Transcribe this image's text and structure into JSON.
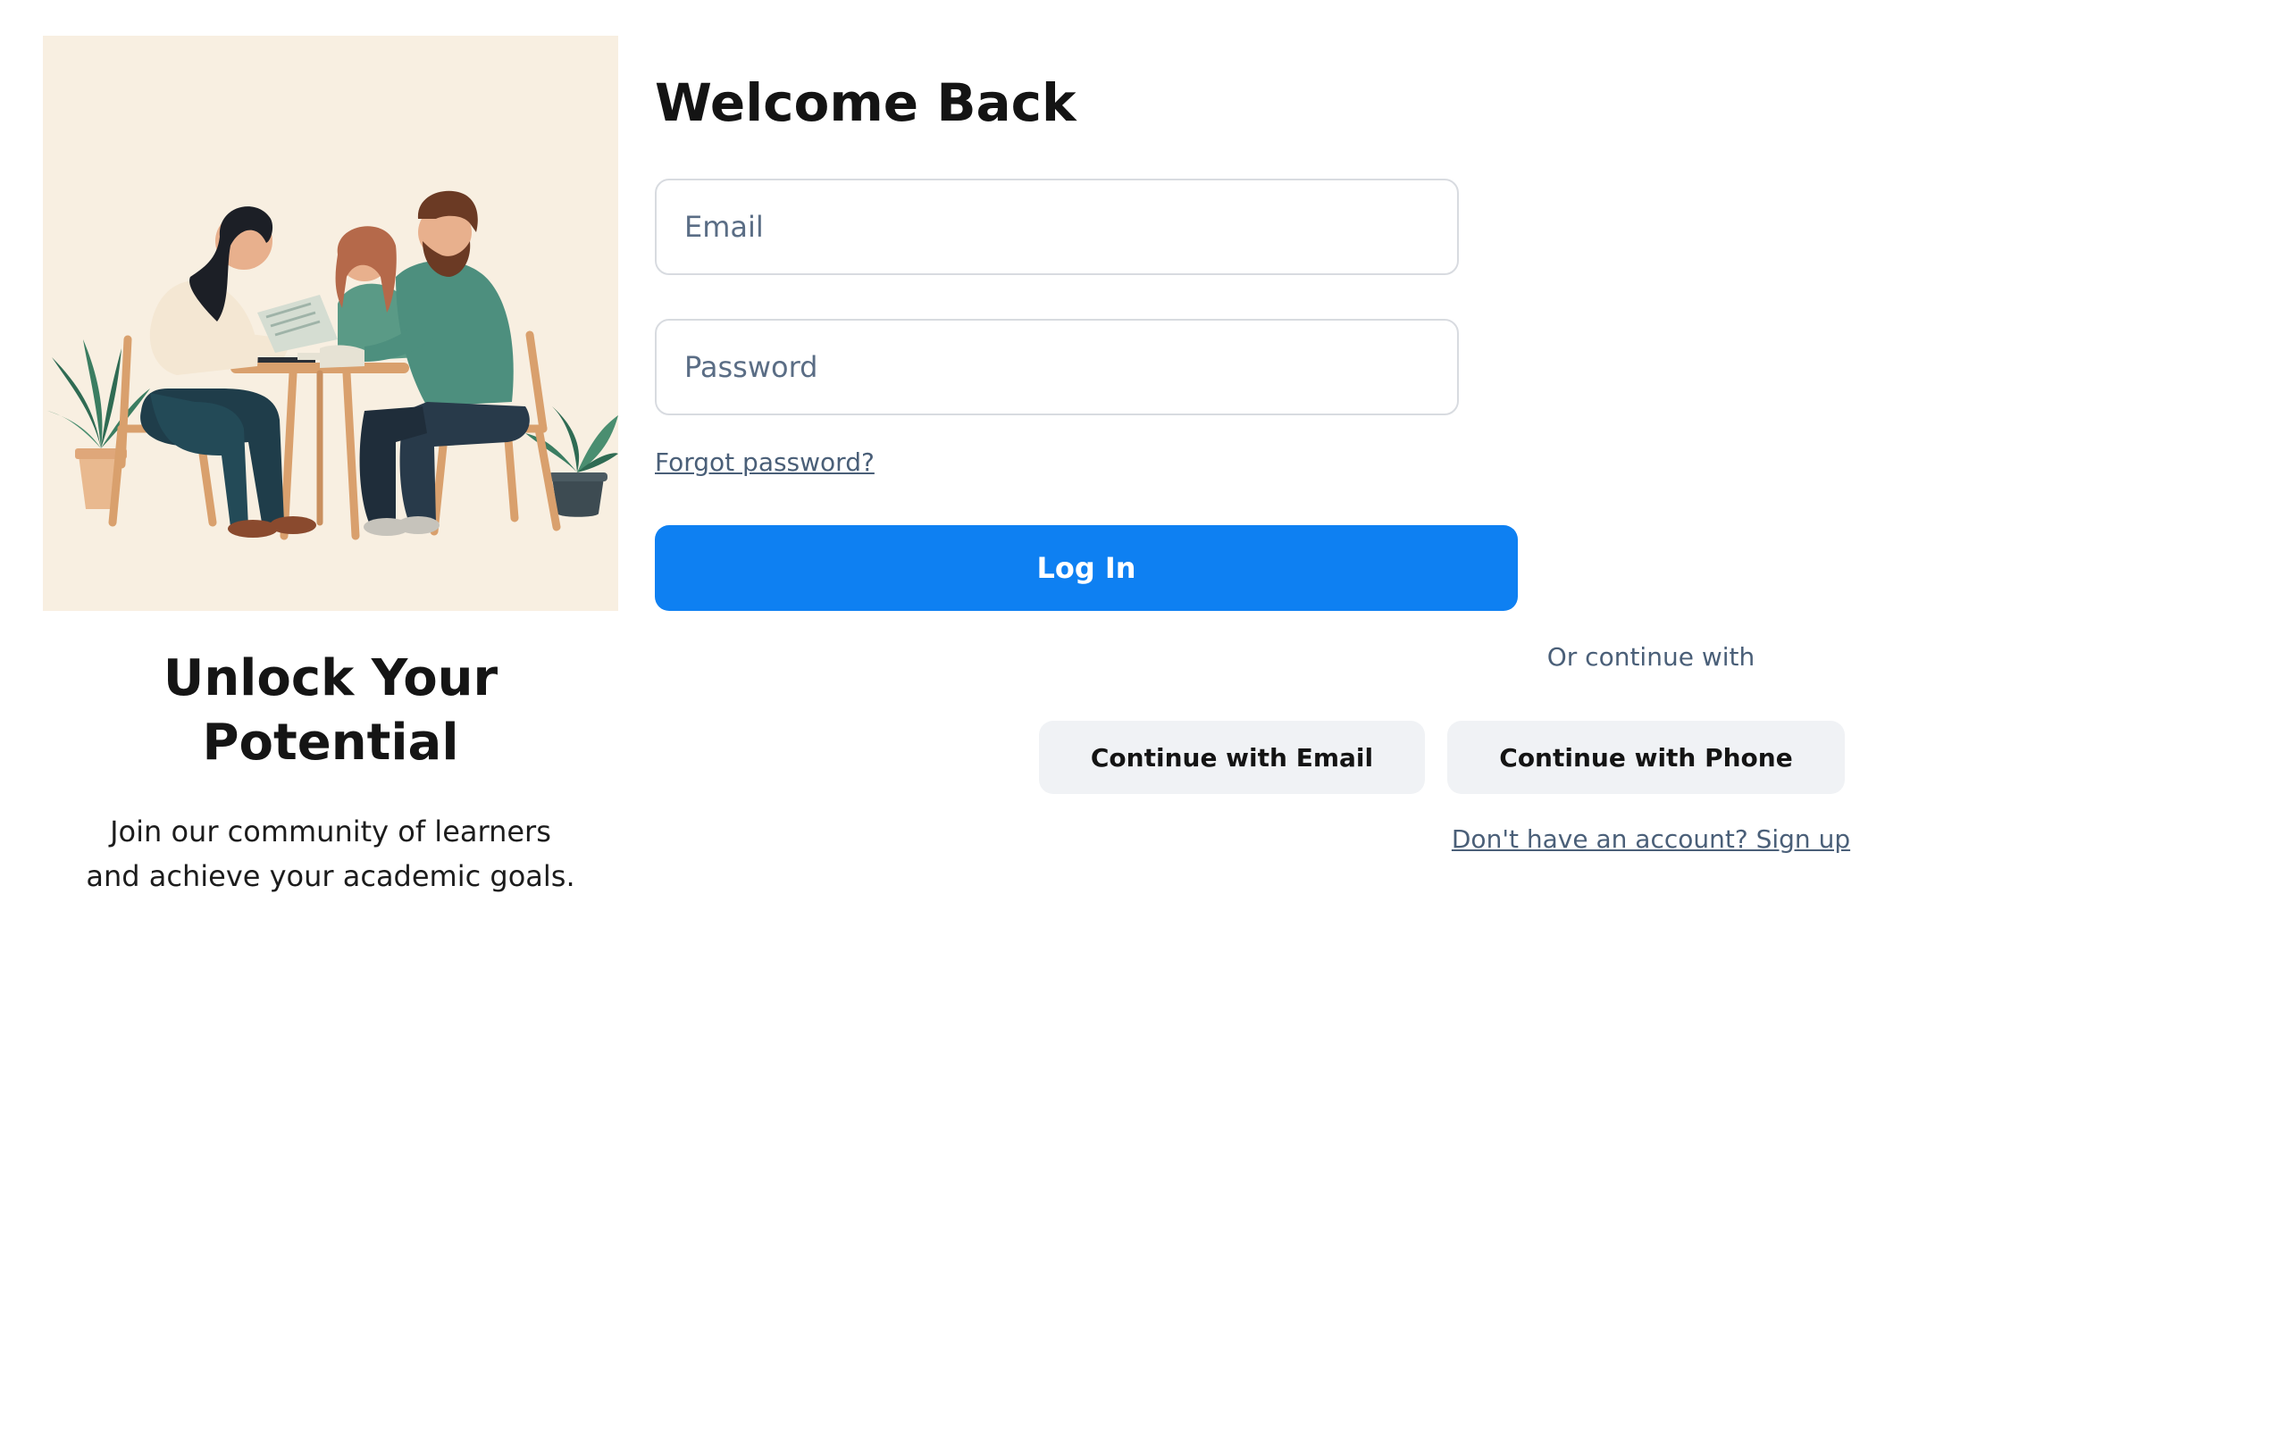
{
  "hero": {
    "title": "Unlock Your Potential",
    "subtitle": "Join our community of learners and achieve your academic goals."
  },
  "login": {
    "title": "Welcome Back",
    "email_placeholder": "Email",
    "password_placeholder": "Password",
    "forgot_password": "Forgot password?",
    "login_button": "Log In",
    "or_continue": "Or continue with",
    "continue_email": "Continue with Email",
    "continue_phone": "Continue with Phone",
    "signup_link": "Don't have an account? Sign up"
  },
  "colors": {
    "primary": "#0e80f2",
    "muted_text": "#4a5f78",
    "secondary_button_bg": "#f0f2f5",
    "illustration_bg": "#f8efe1"
  }
}
